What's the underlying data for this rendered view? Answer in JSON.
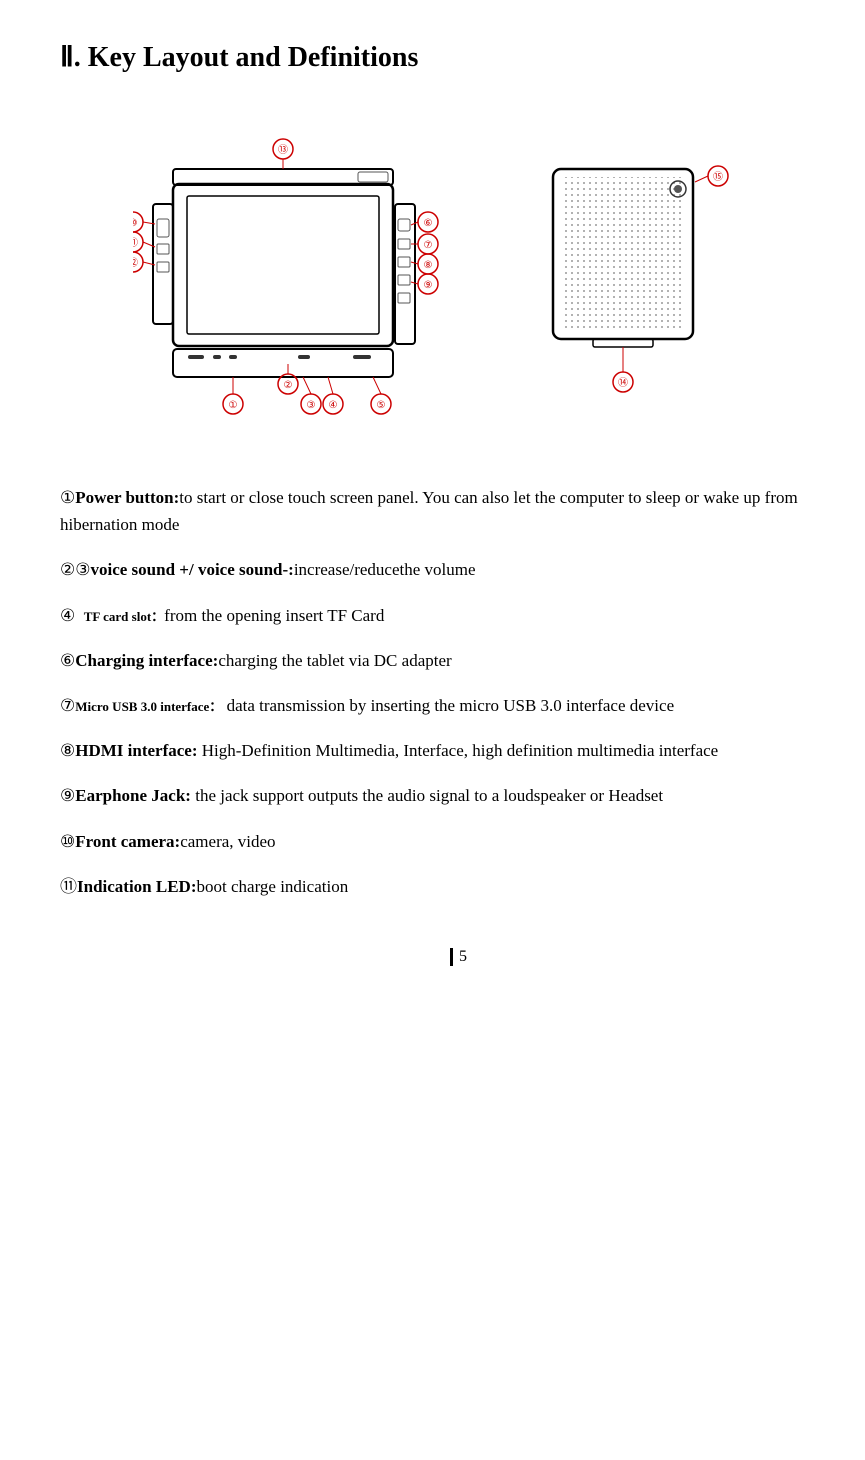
{
  "title": "Ⅱ. Key Layout and Definitions",
  "items": [
    {
      "num": "①",
      "label": "Power button:",
      "text": "to start or close touch screen panel. You can also let the computer to sleep or wake up from hibernation mode"
    },
    {
      "num": "②③",
      "label": "voice sound +/ voice sound-:",
      "text": "increase/reducethe volume"
    },
    {
      "num": "④",
      "label": "TF card slot：",
      "label_class": "tf",
      "text": "from the opening insert TF Card"
    },
    {
      "num": "⑥",
      "label": "Charging interface:",
      "text": "charging the tablet via DC adapter"
    },
    {
      "num": "⑦",
      "label": "Micro  USB  3.0  interface：",
      "label_class": "usb",
      "text": " data  transmission  by  inserting  the  micro  USB  3.0 interface device"
    },
    {
      "num": "⑧",
      "label": "HDMI   interface:",
      "text": " High-Definition  Multimedia,  Interface,  high  definition multimedia interface"
    },
    {
      "num": "⑨",
      "label": "Earphone  Jack:",
      "text": " the  jack  support  outputs  the  audio  signal  to  a  loudspeaker  or Headset"
    },
    {
      "num": "⑩",
      "label": "Front camera:",
      "text": "camera, video"
    },
    {
      "num": "⑪",
      "label": "Indication LED:",
      "text": "boot charge indication"
    }
  ],
  "page_number": "5"
}
